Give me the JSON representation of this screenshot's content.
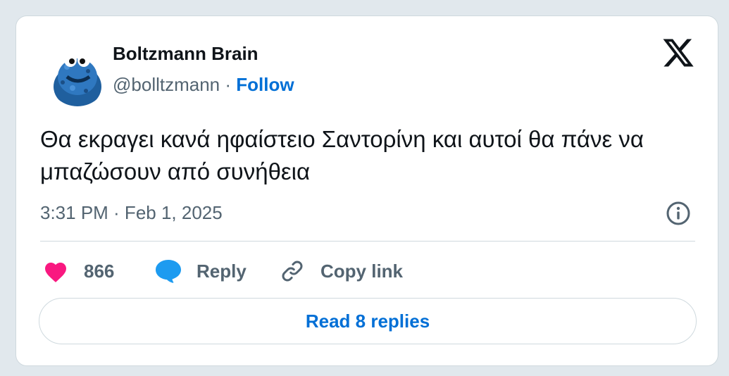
{
  "author": {
    "name": "Boltzmann Brain",
    "handle": "@bolltzmann",
    "separator": " · ",
    "follow_label": "Follow"
  },
  "tweet": {
    "text": "Θα εκραγει κανά ηφαίστειο Σαντορίνη και αυτοί θα πάνε να μπαζώσουν από συνήθεια",
    "timestamp": "3:31 PM · Feb 1, 2025"
  },
  "actions": {
    "like_count": "866",
    "reply_label": "Reply",
    "copy_label": "Copy link"
  },
  "read_replies_label": "Read 8 replies",
  "icons": {
    "logo": "x-logo-icon",
    "info": "info-icon",
    "like": "heart-icon",
    "reply": "speech-bubble-icon",
    "copy": "link-icon"
  },
  "colors": {
    "heart": "#f91880",
    "reply_bubble": "#1d9bf0",
    "link_blue": "#006fd6",
    "muted": "#536471"
  }
}
